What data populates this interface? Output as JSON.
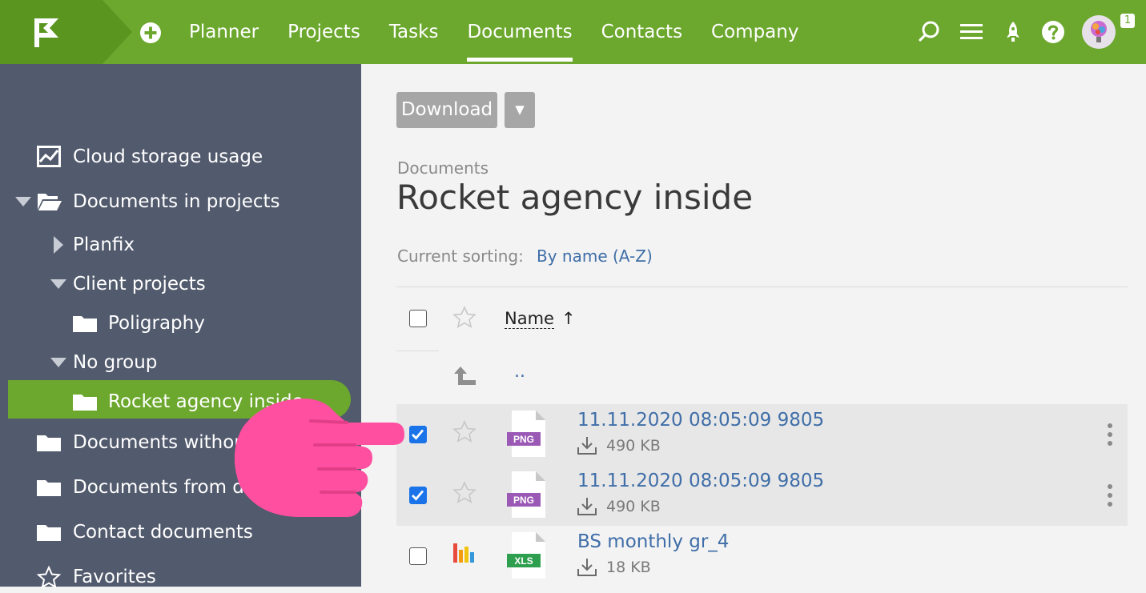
{
  "nav": {
    "items": [
      "Planner",
      "Projects",
      "Tasks",
      "Documents",
      "Contacts",
      "Company"
    ],
    "active": "Documents",
    "notification_count": "1"
  },
  "sidebar": {
    "cloud": "Cloud storage usage",
    "docs_in_projects": "Documents in projects",
    "planfix": "Planfix",
    "client_projects": "Client projects",
    "poligraphy": "Poligraphy",
    "no_group": "No group",
    "rocket": "Rocket agency inside",
    "without": "Documents without",
    "from_dir": "Documents from dire",
    "contact_docs": "Contact documents",
    "favorites": "Favorites"
  },
  "toolbar": {
    "download_label": "Download",
    "dropdown_label": "▾"
  },
  "breadcrumb": "Documents",
  "page_title": "Rocket agency inside",
  "sorting": {
    "label": "Current sorting:",
    "value": "By name (A-Z)"
  },
  "table": {
    "name_header": "Name",
    "sort_arrow": "↑",
    "parent_link": "..",
    "rows": [
      {
        "name": "11.11.2020 08:05:09 9805",
        "size": "490 KB",
        "type": "PNG",
        "checked": true
      },
      {
        "name": "11.11.2020 08:05:09 9805",
        "size": "490 KB",
        "type": "PNG",
        "checked": true
      },
      {
        "name": "BS monthly gr_4",
        "size": "18 KB",
        "type": "XLS",
        "checked": false
      }
    ]
  },
  "colors": {
    "accent": "#6ca82e",
    "sidebar": "#525a6d",
    "link": "#3f6ea8",
    "png": "#9b59b6",
    "xls": "#2e9e4f",
    "pointer_hand": "#ff4fa0"
  }
}
